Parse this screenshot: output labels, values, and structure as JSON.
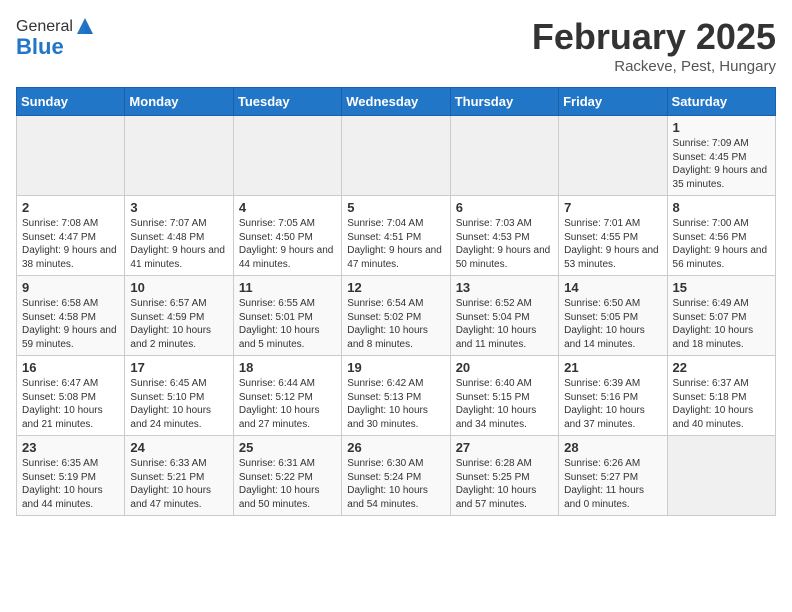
{
  "header": {
    "logo_general": "General",
    "logo_blue": "Blue",
    "title": "February 2025",
    "subtitle": "Rackeve, Pest, Hungary"
  },
  "days_of_week": [
    "Sunday",
    "Monday",
    "Tuesday",
    "Wednesday",
    "Thursday",
    "Friday",
    "Saturday"
  ],
  "weeks": [
    [
      {
        "day": "",
        "info": ""
      },
      {
        "day": "",
        "info": ""
      },
      {
        "day": "",
        "info": ""
      },
      {
        "day": "",
        "info": ""
      },
      {
        "day": "",
        "info": ""
      },
      {
        "day": "",
        "info": ""
      },
      {
        "day": "1",
        "info": "Sunrise: 7:09 AM\nSunset: 4:45 PM\nDaylight: 9 hours and 35 minutes."
      }
    ],
    [
      {
        "day": "2",
        "info": "Sunrise: 7:08 AM\nSunset: 4:47 PM\nDaylight: 9 hours and 38 minutes."
      },
      {
        "day": "3",
        "info": "Sunrise: 7:07 AM\nSunset: 4:48 PM\nDaylight: 9 hours and 41 minutes."
      },
      {
        "day": "4",
        "info": "Sunrise: 7:05 AM\nSunset: 4:50 PM\nDaylight: 9 hours and 44 minutes."
      },
      {
        "day": "5",
        "info": "Sunrise: 7:04 AM\nSunset: 4:51 PM\nDaylight: 9 hours and 47 minutes."
      },
      {
        "day": "6",
        "info": "Sunrise: 7:03 AM\nSunset: 4:53 PM\nDaylight: 9 hours and 50 minutes."
      },
      {
        "day": "7",
        "info": "Sunrise: 7:01 AM\nSunset: 4:55 PM\nDaylight: 9 hours and 53 minutes."
      },
      {
        "day": "8",
        "info": "Sunrise: 7:00 AM\nSunset: 4:56 PM\nDaylight: 9 hours and 56 minutes."
      }
    ],
    [
      {
        "day": "9",
        "info": "Sunrise: 6:58 AM\nSunset: 4:58 PM\nDaylight: 9 hours and 59 minutes."
      },
      {
        "day": "10",
        "info": "Sunrise: 6:57 AM\nSunset: 4:59 PM\nDaylight: 10 hours and 2 minutes."
      },
      {
        "day": "11",
        "info": "Sunrise: 6:55 AM\nSunset: 5:01 PM\nDaylight: 10 hours and 5 minutes."
      },
      {
        "day": "12",
        "info": "Sunrise: 6:54 AM\nSunset: 5:02 PM\nDaylight: 10 hours and 8 minutes."
      },
      {
        "day": "13",
        "info": "Sunrise: 6:52 AM\nSunset: 5:04 PM\nDaylight: 10 hours and 11 minutes."
      },
      {
        "day": "14",
        "info": "Sunrise: 6:50 AM\nSunset: 5:05 PM\nDaylight: 10 hours and 14 minutes."
      },
      {
        "day": "15",
        "info": "Sunrise: 6:49 AM\nSunset: 5:07 PM\nDaylight: 10 hours and 18 minutes."
      }
    ],
    [
      {
        "day": "16",
        "info": "Sunrise: 6:47 AM\nSunset: 5:08 PM\nDaylight: 10 hours and 21 minutes."
      },
      {
        "day": "17",
        "info": "Sunrise: 6:45 AM\nSunset: 5:10 PM\nDaylight: 10 hours and 24 minutes."
      },
      {
        "day": "18",
        "info": "Sunrise: 6:44 AM\nSunset: 5:12 PM\nDaylight: 10 hours and 27 minutes."
      },
      {
        "day": "19",
        "info": "Sunrise: 6:42 AM\nSunset: 5:13 PM\nDaylight: 10 hours and 30 minutes."
      },
      {
        "day": "20",
        "info": "Sunrise: 6:40 AM\nSunset: 5:15 PM\nDaylight: 10 hours and 34 minutes."
      },
      {
        "day": "21",
        "info": "Sunrise: 6:39 AM\nSunset: 5:16 PM\nDaylight: 10 hours and 37 minutes."
      },
      {
        "day": "22",
        "info": "Sunrise: 6:37 AM\nSunset: 5:18 PM\nDaylight: 10 hours and 40 minutes."
      }
    ],
    [
      {
        "day": "23",
        "info": "Sunrise: 6:35 AM\nSunset: 5:19 PM\nDaylight: 10 hours and 44 minutes."
      },
      {
        "day": "24",
        "info": "Sunrise: 6:33 AM\nSunset: 5:21 PM\nDaylight: 10 hours and 47 minutes."
      },
      {
        "day": "25",
        "info": "Sunrise: 6:31 AM\nSunset: 5:22 PM\nDaylight: 10 hours and 50 minutes."
      },
      {
        "day": "26",
        "info": "Sunrise: 6:30 AM\nSunset: 5:24 PM\nDaylight: 10 hours and 54 minutes."
      },
      {
        "day": "27",
        "info": "Sunrise: 6:28 AM\nSunset: 5:25 PM\nDaylight: 10 hours and 57 minutes."
      },
      {
        "day": "28",
        "info": "Sunrise: 6:26 AM\nSunset: 5:27 PM\nDaylight: 11 hours and 0 minutes."
      },
      {
        "day": "",
        "info": ""
      }
    ]
  ]
}
